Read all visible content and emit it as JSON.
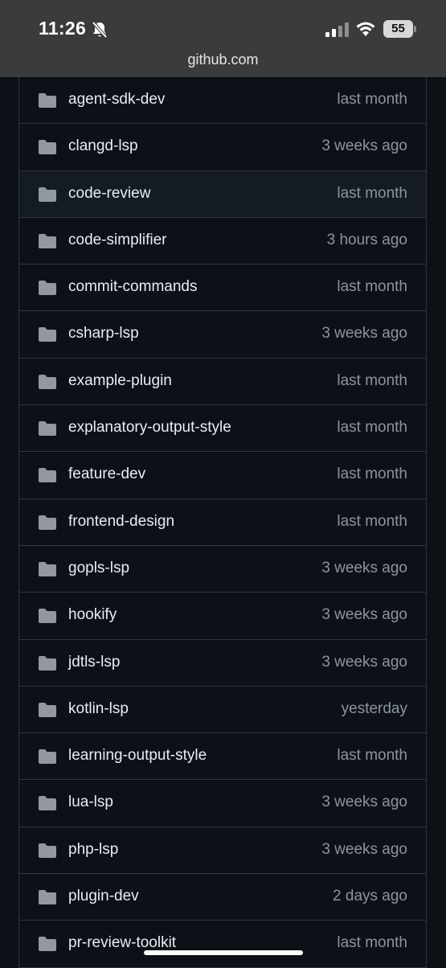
{
  "status_bar": {
    "time": "11:26",
    "battery": "55",
    "url": "github.com"
  },
  "files": [
    {
      "name": "agent-sdk-dev",
      "time": "last month"
    },
    {
      "name": "clangd-lsp",
      "time": "3 weeks ago"
    },
    {
      "name": "code-review",
      "time": "last month"
    },
    {
      "name": "code-simplifier",
      "time": "3 hours ago"
    },
    {
      "name": "commit-commands",
      "time": "last month"
    },
    {
      "name": "csharp-lsp",
      "time": "3 weeks ago"
    },
    {
      "name": "example-plugin",
      "time": "last month"
    },
    {
      "name": "explanatory-output-style",
      "time": "last month"
    },
    {
      "name": "feature-dev",
      "time": "last month"
    },
    {
      "name": "frontend-design",
      "time": "last month"
    },
    {
      "name": "gopls-lsp",
      "time": "3 weeks ago"
    },
    {
      "name": "hookify",
      "time": "3 weeks ago"
    },
    {
      "name": "jdtls-lsp",
      "time": "3 weeks ago"
    },
    {
      "name": "kotlin-lsp",
      "time": "yesterday"
    },
    {
      "name": "learning-output-style",
      "time": "last month"
    },
    {
      "name": "lua-lsp",
      "time": "3 weeks ago"
    },
    {
      "name": "php-lsp",
      "time": "3 weeks ago"
    },
    {
      "name": "plugin-dev",
      "time": "2 days ago"
    },
    {
      "name": "pr-review-toolkit",
      "time": "last month"
    }
  ],
  "icons": {
    "folder": "folder-icon",
    "bell": "bell-off-icon",
    "signal": "cellular-signal-icon",
    "wifi": "wifi-icon",
    "battery": "battery-icon"
  },
  "colors": {
    "background": "#0d1117",
    "border": "#30363d",
    "folder": "#9198a1",
    "text": "#e6edf3",
    "muted": "#8b949e",
    "status_bar": "#3a3b3d"
  }
}
